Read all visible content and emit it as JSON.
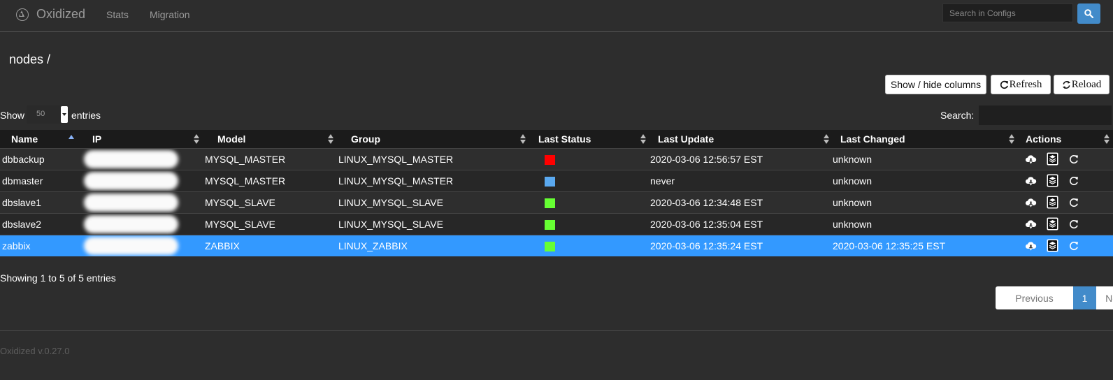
{
  "navbar": {
    "brand": "Oxidized",
    "links": [
      "Stats",
      "Migration"
    ],
    "search_placeholder": "Search in Configs"
  },
  "breadcrumb": "nodes /",
  "toolbar": {
    "show_hide_columns": "Show / hide columns",
    "refresh": "Refresh",
    "reload": "Reload"
  },
  "length_menu": {
    "show": "Show",
    "value": "50",
    "entries": "entries"
  },
  "search_label": "Search:",
  "table": {
    "columns": [
      "Name",
      "IP",
      "Model",
      "Group",
      "Last Status",
      "Last Update",
      "Last Changed",
      "Actions"
    ],
    "rows": [
      {
        "name": "dbbackup",
        "model": "MYSQL_MASTER",
        "group": "LINUX_MYSQL_MASTER",
        "status": "#ff0000",
        "last_update": "2020-03-06 12:56:57 EST",
        "last_changed": "unknown",
        "selected": false
      },
      {
        "name": "dbmaster",
        "model": "MYSQL_MASTER",
        "group": "LINUX_MYSQL_MASTER",
        "status": "#5aa9f0",
        "last_update": "never",
        "last_changed": "unknown",
        "selected": false
      },
      {
        "name": "dbslave1",
        "model": "MYSQL_SLAVE",
        "group": "LINUX_MYSQL_SLAVE",
        "status": "#66ff33",
        "last_update": "2020-03-06 12:34:48 EST",
        "last_changed": "unknown",
        "selected": false
      },
      {
        "name": "dbslave2",
        "model": "MYSQL_SLAVE",
        "group": "LINUX_MYSQL_SLAVE",
        "status": "#66ff33",
        "last_update": "2020-03-06 12:35:04 EST",
        "last_changed": "unknown",
        "selected": false
      },
      {
        "name": "zabbix",
        "model": "ZABBIX",
        "group": "LINUX_ZABBIX",
        "status": "#66ff33",
        "last_update": "2020-03-06 12:35:24 EST",
        "last_changed": "2020-03-06 12:35:25 EST",
        "selected": true
      }
    ]
  },
  "info": "Showing 1 to 5 of 5 entries",
  "pagination": {
    "previous": "Previous",
    "current": "1",
    "next": "Next"
  },
  "footer": {
    "version": "Oxidized v.0.27.0"
  },
  "colors": {
    "accent": "#428bca",
    "selected_row": "#3399ff",
    "background": "#2d2d2d"
  },
  "icons": [
    "oxidized-logo-icon",
    "search-icon",
    "refresh-icon",
    "reload-icon",
    "cloud-download-icon",
    "layers-icon",
    "update-icon"
  ]
}
